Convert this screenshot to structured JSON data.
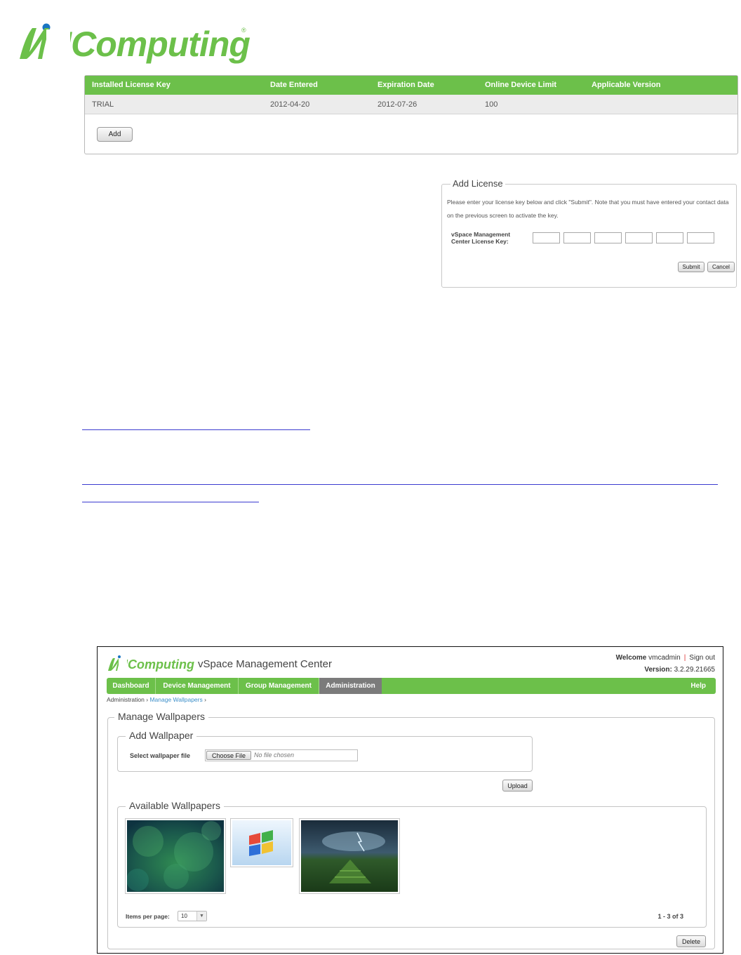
{
  "logo": {
    "text": "NComputing",
    "registered": "®"
  },
  "license_table": {
    "headers": [
      "Installed License Key",
      "Date Entered",
      "Expiration Date",
      "Online Device Limit",
      "Applicable Version"
    ],
    "rows": [
      {
        "key": "TRIAL",
        "date_entered": "2012-04-20",
        "expiration": "2012-07-26",
        "limit": "100",
        "version": ""
      }
    ],
    "add_label": "Add"
  },
  "add_license": {
    "legend": "Add License",
    "instructions": "Please enter your license key below and click \"Submit\". Note that you must have entered your contact data on the previous screen to activate the key.",
    "key_label_line1": "vSpace Management",
    "key_label_line2": "Center License Key:",
    "submit_label": "Submit",
    "cancel_label": "Cancel"
  },
  "vspace": {
    "logo_text": "NComputing",
    "title": "vSpace Management Center",
    "welcome_label": "Welcome",
    "username": "vmcadmin",
    "separator": "|",
    "signout_label": "Sign out",
    "version_label": "Version:",
    "version_value": "3.2.29.21665",
    "nav": [
      "Dashboard",
      "Device Management",
      "Group Management",
      "Administration"
    ],
    "help_label": "Help",
    "breadcrumb": {
      "root": "Administration",
      "current": "Manage Wallpapers",
      "sep": "›"
    },
    "manage_legend": "Manage Wallpapers",
    "add_legend": "Add Wallpaper",
    "select_label": "Select wallpaper file",
    "choose_label": "Choose File",
    "no_file": "No file chosen",
    "upload_label": "Upload",
    "available_legend": "Available Wallpapers",
    "items_per_page_label": "Items per page:",
    "items_per_page_value": "10",
    "page_count": "1 - 3 of 3",
    "delete_label": "Delete"
  },
  "colors": {
    "brand_green": "#6cc04a",
    "brand_blue": "#1a75c2",
    "active_tab": "#7b7b7b",
    "link_blue": "#3d8fc9"
  }
}
